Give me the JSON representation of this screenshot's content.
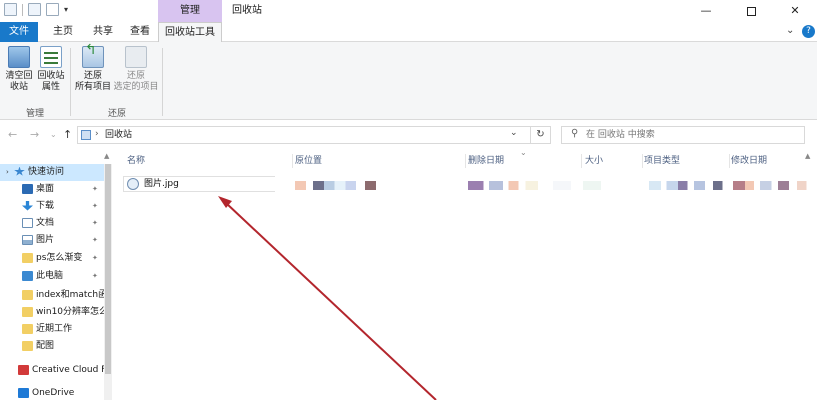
{
  "titlebar": {
    "context_tab": "管理",
    "title": "回收站",
    "minimize": "—",
    "close": "✕"
  },
  "ribbon_tabs": {
    "file": "文件",
    "home": "主页",
    "share": "共享",
    "view": "查看",
    "recycle_tools": "回收站工具"
  },
  "ribbon": {
    "empty_bin": [
      "清空回",
      "收站"
    ],
    "bin_props": [
      "回收站",
      "属性"
    ],
    "restore_all": [
      "还原",
      "所有项目"
    ],
    "restore_selected": [
      "还原",
      "选定的项目"
    ],
    "group_manage": "管理",
    "group_restore": "还原"
  },
  "address": {
    "path": "回收站",
    "search_placeholder": "在 回收站 中搜索"
  },
  "navpane": {
    "items": [
      {
        "label": "快速访问",
        "icon": "star-icon"
      },
      {
        "label": "桌面",
        "icon": "desktop-icon"
      },
      {
        "label": "下载",
        "icon": "download-icon"
      },
      {
        "label": "文档",
        "icon": "document-icon"
      },
      {
        "label": "图片",
        "icon": "pictures-icon"
      },
      {
        "label": "ps怎么渐变",
        "icon": "folder-icon"
      },
      {
        "label": "此电脑",
        "icon": "computer-icon"
      },
      {
        "label": "index和match函",
        "icon": "folder-icon"
      },
      {
        "label": "win10分辨率怎么",
        "icon": "folder-icon"
      },
      {
        "label": "近期工作",
        "icon": "folder-icon"
      },
      {
        "label": "配图",
        "icon": "folder-icon"
      },
      {
        "label": "Creative Cloud F",
        "icon": "creative-cloud-icon"
      },
      {
        "label": "OneDrive",
        "icon": "onedrive-icon"
      }
    ]
  },
  "columns": {
    "name": "名称",
    "original_location": "原位置",
    "date_deleted": "删除日期",
    "size": "大小",
    "item_type": "项目类型",
    "date_modified": "修改日期"
  },
  "files": [
    {
      "name": "图片.jpg"
    }
  ],
  "colors": {
    "file_tab": "#1979ca",
    "context_tab": "#d8c4f0",
    "selected_nav": "#cce8ff",
    "annotation_arrow": "#b3262d"
  }
}
